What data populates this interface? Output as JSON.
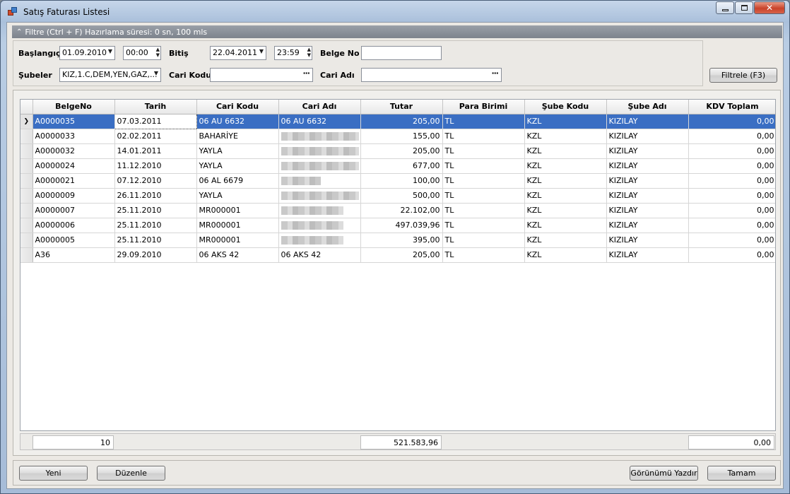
{
  "window": {
    "title": "Satış Faturası Listesi",
    "close_glyph": "✕"
  },
  "filter": {
    "header": "Filtre (Ctrl + F) Hazırlama süresi: 0 sn, 100 mls",
    "start_label": "Başlangıç",
    "start_date": "01.09.2010",
    "start_time": "00:00",
    "end_label": "Bitiş",
    "end_date": "22.04.2011",
    "end_time": "23:59",
    "docno_label": "Belge No",
    "docno_value": "",
    "branches_label": "Şubeler",
    "branches_value": "KIZ,1.C,DEM,YEN,GAZ,...",
    "cari_kodu_label": "Cari Kodu",
    "cari_kodu_value": "",
    "cari_adi_label": "Cari Adı",
    "cari_adi_value": "",
    "filter_button": "Filtrele (F3)"
  },
  "grid": {
    "columns": [
      "BelgeNo",
      "Tarih",
      "Cari Kodu",
      "Cari Adı",
      "Tutar",
      "Para Birimi",
      "Şube Kodu",
      "Şube Adı",
      "KDV Toplam"
    ],
    "rows": [
      {
        "belgeno": "A0000035",
        "tarih": "07.03.2011",
        "cari_kodu": "06 AU 6632",
        "cari_adi": "06 AU 6632",
        "tutar": "205,00",
        "para": "TL",
        "sube_kodu": "KZL",
        "sube_adi": "KIZILAY",
        "kdv": "0,00"
      },
      {
        "belgeno": "A0000033",
        "tarih": "02.02.2011",
        "cari_kodu": "BAHARİYE",
        "cari_adi": "",
        "tutar": "155,00",
        "para": "TL",
        "sube_kodu": "KZL",
        "sube_adi": "KIZILAY",
        "kdv": "0,00"
      },
      {
        "belgeno": "A0000032",
        "tarih": "14.01.2011",
        "cari_kodu": "YAYLA",
        "cari_adi": "",
        "tutar": "205,00",
        "para": "TL",
        "sube_kodu": "KZL",
        "sube_adi": "KIZILAY",
        "kdv": "0,00"
      },
      {
        "belgeno": "A0000024",
        "tarih": "11.12.2010",
        "cari_kodu": "YAYLA",
        "cari_adi": "",
        "tutar": "677,00",
        "para": "TL",
        "sube_kodu": "KZL",
        "sube_adi": "KIZILAY",
        "kdv": "0,00"
      },
      {
        "belgeno": "A0000021",
        "tarih": "07.12.2010",
        "cari_kodu": "06 AL 6679",
        "cari_adi": "",
        "tutar": "100,00",
        "para": "TL",
        "sube_kodu": "KZL",
        "sube_adi": "KIZILAY",
        "kdv": "0,00"
      },
      {
        "belgeno": "A0000009",
        "tarih": "26.11.2010",
        "cari_kodu": "YAYLA",
        "cari_adi": "",
        "tutar": "500,00",
        "para": "TL",
        "sube_kodu": "KZL",
        "sube_adi": "KIZILAY",
        "kdv": "0,00"
      },
      {
        "belgeno": "A0000007",
        "tarih": "25.11.2010",
        "cari_kodu": "MR000001",
        "cari_adi": "",
        "tutar": "22.102,00",
        "para": "TL",
        "sube_kodu": "KZL",
        "sube_adi": "KIZILAY",
        "kdv": "0,00"
      },
      {
        "belgeno": "A0000006",
        "tarih": "25.11.2010",
        "cari_kodu": "MR000001",
        "cari_adi": "",
        "tutar": "497.039,96",
        "para": "TL",
        "sube_kodu": "KZL",
        "sube_adi": "KIZILAY",
        "kdv": "0,00"
      },
      {
        "belgeno": "A0000005",
        "tarih": "25.11.2010",
        "cari_kodu": "MR000001",
        "cari_adi": "",
        "tutar": "395,00",
        "para": "TL",
        "sube_kodu": "KZL",
        "sube_adi": "KIZILAY",
        "kdv": "0,00"
      },
      {
        "belgeno": "A36",
        "tarih": "29.09.2010",
        "cari_kodu": "06 AKS 42",
        "cari_adi": "06 AKS 42",
        "tutar": "205,00",
        "para": "TL",
        "sube_kodu": "KZL",
        "sube_adi": "KIZILAY",
        "kdv": "0,00"
      }
    ],
    "footer": {
      "count": "10",
      "tutar_total": "521.583,96",
      "kdv_total": "0,00"
    }
  },
  "buttons": {
    "new": "Yeni",
    "edit": "Düzenle",
    "print_view": "Görünümü Yazdır",
    "ok": "Tamam"
  },
  "icons": {
    "collapse": "double-chevron-up-icon",
    "row_indicator": "row-pointer-icon"
  }
}
